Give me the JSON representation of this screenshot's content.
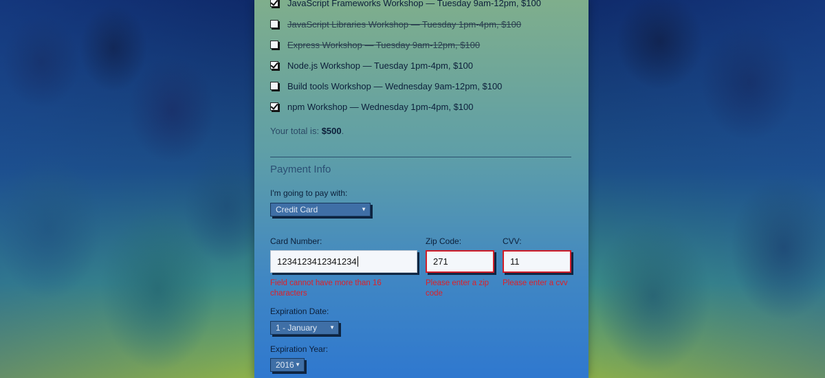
{
  "activities": [
    {
      "label": "JavaScript Frameworks Workshop — Tuesday 9am-12pm, $100",
      "checked": true,
      "disabled": false
    },
    {
      "label": "JavaScript Libraries Workshop — Tuesday 1pm-4pm, $100",
      "checked": false,
      "disabled": true
    },
    {
      "label": "Express Workshop — Tuesday 9am-12pm, $100",
      "checked": false,
      "disabled": true
    },
    {
      "label": "Node.js Workshop — Tuesday 1pm-4pm, $100",
      "checked": true,
      "disabled": false
    },
    {
      "label": "Build tools Workshop — Wednesday 9am-12pm, $100",
      "checked": false,
      "disabled": false
    },
    {
      "label": "npm Workshop — Wednesday 1pm-4pm, $100",
      "checked": true,
      "disabled": false
    }
  ],
  "total": {
    "prefix": "Your total is: ",
    "amount": "$500",
    "suffix": "."
  },
  "payment": {
    "section_title": "Payment Info",
    "pay_with_label": "I'm going to pay with:",
    "pay_with_value": "Credit Card",
    "card_number_label": "Card Number:",
    "card_number_value": "1234123412341234",
    "card_number_error": "Field cannot have more than 16 characters",
    "zip_label": "Zip Code:",
    "zip_value": "271",
    "zip_error": "Please enter a zip code",
    "cvv_label": "CVV:",
    "cvv_value": "11",
    "cvv_error": "Please enter a cvv",
    "exp_date_label": "Expiration Date:",
    "exp_date_value": "1 - January",
    "exp_year_label": "Expiration Year:",
    "exp_year_value": "2016"
  },
  "colors": {
    "error": "#e01e26",
    "panel_top": "#7fae8c",
    "panel_bottom": "#2f78cf"
  },
  "icons": {
    "dropdown": "triangle-down-icon",
    "checkbox": "checkbox-icon"
  }
}
